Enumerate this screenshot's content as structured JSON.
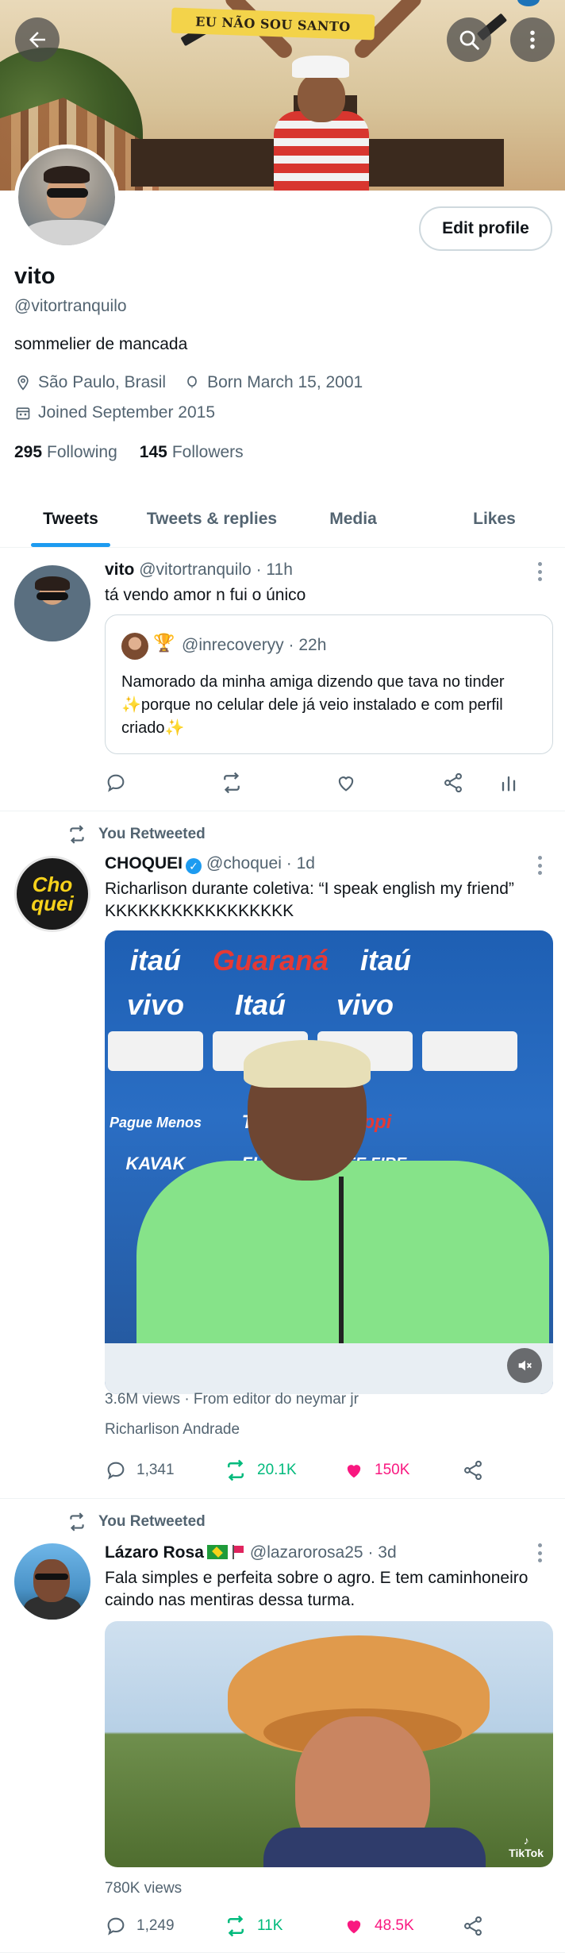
{
  "banner": {
    "ribbon_text": "EU NÃO SOU SANTO"
  },
  "profile": {
    "name": "vito",
    "handle": "@vitortranquilo",
    "bio": "sommelier de mancada",
    "location": "São Paulo, Brasil",
    "birthday": "Born March 15, 2001",
    "joined": "Joined September 2015",
    "following_count": "295",
    "following_label": "Following",
    "followers_count": "145",
    "followers_label": "Followers",
    "edit_label": "Edit profile"
  },
  "tabs": [
    {
      "label": "Tweets",
      "active": true
    },
    {
      "label": "Tweets & replies",
      "active": false
    },
    {
      "label": "Media",
      "active": false
    },
    {
      "label": "Likes",
      "active": false
    }
  ],
  "tweets": [
    {
      "name": "vito",
      "handle": "@vitortranquilo",
      "time": "· 11h",
      "text": "tá vendo amor n fui o único",
      "quote": {
        "handle": "@inrecoveryy",
        "time": "· 22h",
        "text": "Namorado da minha amiga dizendo que tava no tinder ✨porque no celular dele já veio instalado e com perfil criado✨"
      }
    },
    {
      "retweet_label": "You Retweeted",
      "name": "CHOQUEI",
      "handle": "@choquei",
      "time": "· 1d",
      "avatar_text": "Cho quei",
      "text": "Richarlison durante coletiva: “I speak english my friend” KKKKKKKKKKKKKKKKK",
      "media_sponsors": [
        "itaú",
        "Guaraná",
        "itaú",
        "vivo",
        "Itaú",
        "vivo",
        "Pague Menos",
        "TCL",
        "Rappi",
        "KAVAK",
        "FIAT",
        "FREE FIRE"
      ],
      "views": "3.6M views",
      "views_sep": "·",
      "from": "From editor do neymar jr",
      "tagged": "Richarlison Andrade",
      "replies": "1,341",
      "retweets": "20.1K",
      "likes": "150K"
    },
    {
      "retweet_label": "You Retweeted",
      "name": "Lázaro Rosa",
      "handle": "@lazarorosa25",
      "time": "· 3d",
      "text": "Fala simples e perfeita sobre o agro. E tem caminhoneiro caindo nas mentiras dessa turma.",
      "media_badge": "TikTok",
      "views": "780K views",
      "replies": "1,249",
      "retweets": "11K",
      "likes": "48.5K"
    }
  ],
  "colors": {
    "accent": "#1d9bf0",
    "retweet_green": "#00ba7c",
    "like_pink": "#f91880",
    "secondary_text": "#536471"
  }
}
